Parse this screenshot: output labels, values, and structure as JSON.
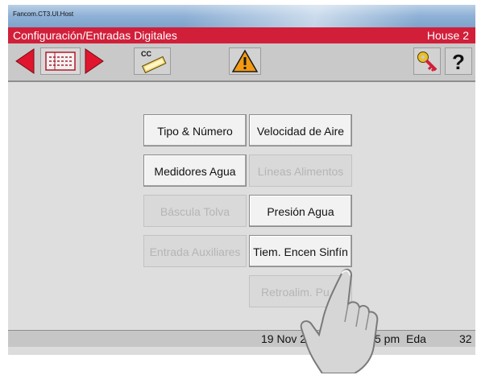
{
  "window": {
    "title": "Fancom.CT3.UI.Host"
  },
  "header": {
    "title": "Configuración/Entradas Digitales",
    "house": "House 2"
  },
  "toolbar": {
    "cc_label": "CC"
  },
  "menu": {
    "tipo_numero": "Tipo & Número",
    "velocidad_aire": "Velocidad de Aire",
    "medidores_agua": "Medidores Agua",
    "lineas_alimentos": "Líneas Alimentos",
    "bascula_tolva": "Báscula Tolva",
    "presion_agua": "Presión Agua",
    "entrada_auxiliares": "Entrada Auxiliares",
    "tiem_encen_sinfin": "Tiem. Encen Sinfín",
    "retroalim": "Retroalim. Pu"
  },
  "status": {
    "date": "19 Nov 20",
    "time_suffix": "5 pm",
    "eda_label": "Eda",
    "eda_value": "32"
  },
  "colors": {
    "header_red": "#d11f3a",
    "arrow_red": "#e0162f",
    "warning_orange": "#f39a12"
  }
}
